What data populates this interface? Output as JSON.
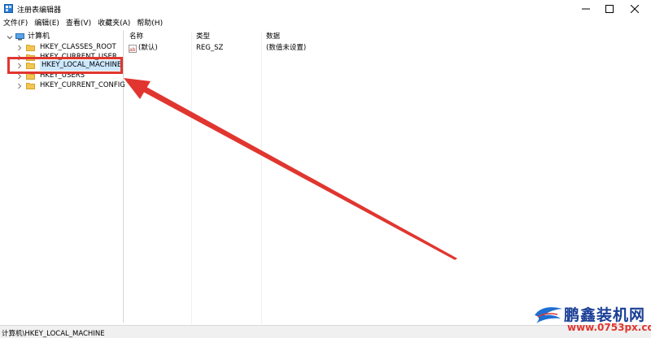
{
  "window": {
    "title": "注册表编辑器",
    "icon": "registry-editor-icon"
  },
  "menu": {
    "items": [
      "文件(F)",
      "编辑(E)",
      "查看(V)",
      "收藏夹(A)",
      "帮助(H)"
    ]
  },
  "tree": {
    "root": "计算机",
    "nodes": [
      {
        "label": "HKEY_CLASSES_ROOT"
      },
      {
        "label": "HKEY_CURRENT_USER"
      },
      {
        "label": "HKEY_LOCAL_MACHINE",
        "selected": true
      },
      {
        "label": "HKEY_USERS"
      },
      {
        "label": "HKEY_CURRENT_CONFIG"
      }
    ]
  },
  "list": {
    "headers": {
      "name": "名称",
      "type": "类型",
      "data": "数据"
    },
    "rows": [
      {
        "name": "(默认)",
        "type": "REG_SZ",
        "data": "(数值未设置)"
      }
    ]
  },
  "status": {
    "path": "计算机\\HKEY_LOCAL_MACHINE"
  },
  "annotation": {
    "color": "#e0362f"
  },
  "watermark": {
    "title": "鹏鑫装机网",
    "url": "www.0753px.com"
  }
}
